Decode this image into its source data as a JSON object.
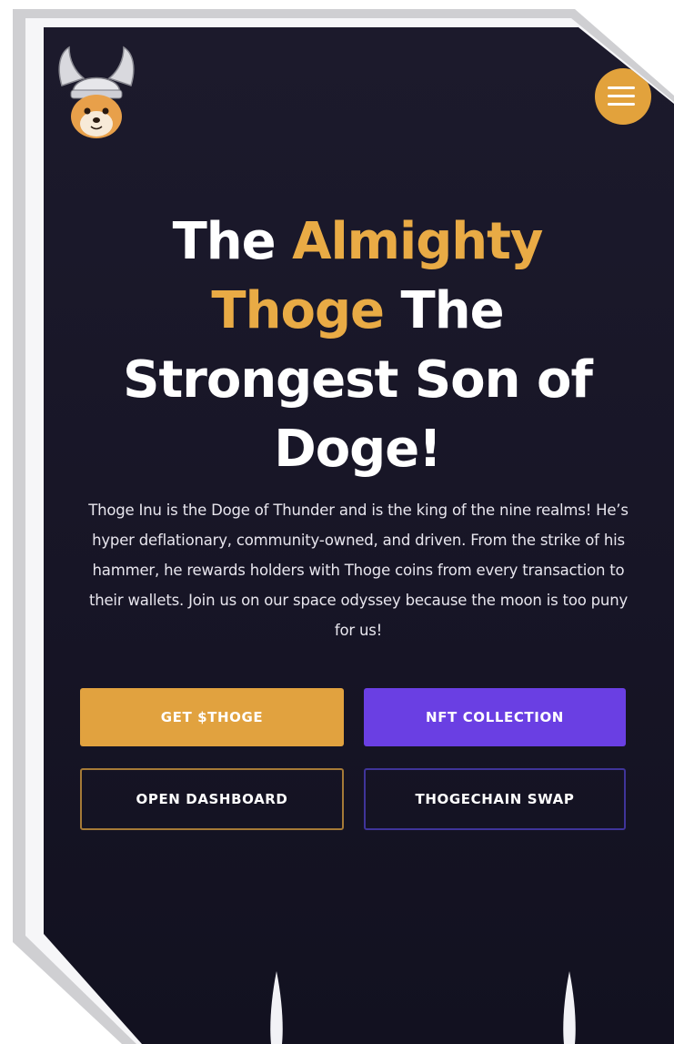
{
  "headline": {
    "part1": "The ",
    "accent": "Almighty Thoge",
    "part2": " The Strongest Son of Doge!"
  },
  "intro": "Thoge Inu is the Doge of Thunder and is the king of the nine realms! He’s hyper deflationary, community-owned, and driven. From the strike of his hammer, he rewards holders with Thoge coins from every transaction to their wallets. Join us on our space odyssey because the moon is too puny for us!",
  "buttons": {
    "get": "GET $THOGE",
    "nft": "NFT COLLECTION",
    "dashboard": "OPEN DASHBOARD",
    "swap": "THOGECHAIN SWAP"
  },
  "icons": {
    "logo": "thoge-dog-viking-helmet-logo",
    "menu": "hamburger-menu-icon"
  },
  "colors": {
    "background": "#1a1829",
    "accent_gold": "#e9ab45",
    "accent_purple": "#6a3fe3",
    "text": "#ffffff"
  }
}
